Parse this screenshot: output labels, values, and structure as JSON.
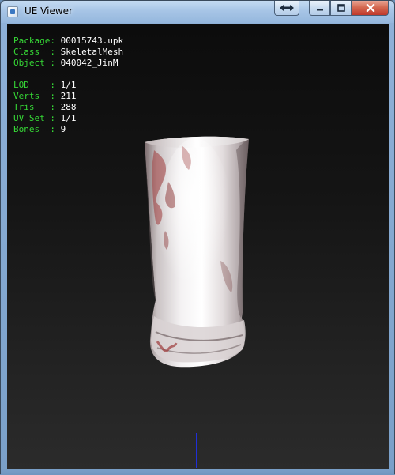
{
  "window": {
    "title": "UE Viewer"
  },
  "colors": {
    "info_key": "#36d836",
    "info_value": "#ffffff",
    "axis_line": "#1f2fd8"
  },
  "icons": {
    "app": "ue-viewer-app-icon",
    "restore_size": "double-arrow-icon",
    "minimize": "minimize-icon",
    "maximize": "maximize-icon",
    "close": "close-icon"
  },
  "info": {
    "package": {
      "label": "Package:",
      "value": "00015743.upk"
    },
    "class": {
      "label": "Class  :",
      "value": "SkeletalMesh"
    },
    "object": {
      "label": "Object :",
      "value": "040042_JinM"
    },
    "lod": {
      "label": "LOD    :",
      "value": "1/1"
    },
    "verts": {
      "label": "Verts  :",
      "value": "211"
    },
    "tris": {
      "label": "Tris   :",
      "value": "288"
    },
    "uvset": {
      "label": "UV Set :",
      "value": "1/1"
    },
    "bones": {
      "label": "Bones  :",
      "value": "9"
    }
  }
}
